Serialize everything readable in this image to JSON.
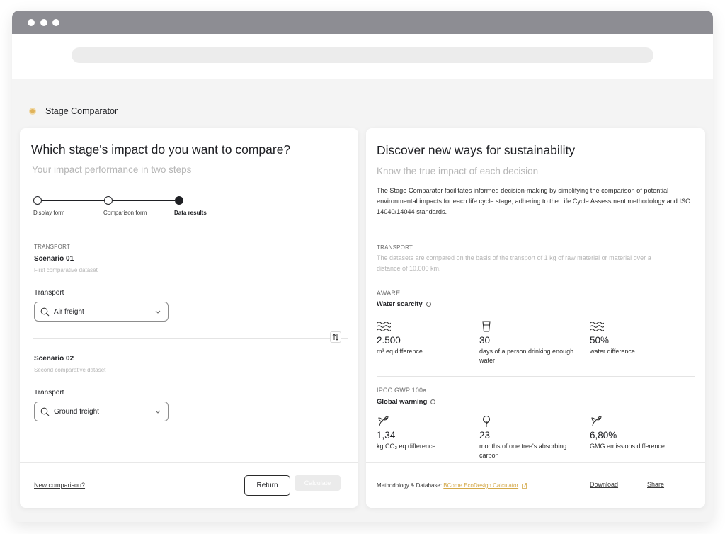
{
  "app": {
    "title": "Stage Comparator"
  },
  "left": {
    "heading": "Which stage's impact do you want to compare?",
    "subheading": "Your impact performance in two steps",
    "steps": [
      {
        "label": "Display form",
        "state": "done"
      },
      {
        "label": "Comparison form",
        "state": "done"
      },
      {
        "label": "Data results",
        "state": "active"
      }
    ],
    "category": "TRANSPORT",
    "scenario1": {
      "title": "Scenario 01",
      "subtitle": "First comparative dataset",
      "field_label": "Transport",
      "value": "Air freight"
    },
    "scenario2": {
      "title": "Scenario 02",
      "subtitle": "Second comparative dataset",
      "field_label": "Transport",
      "value": "Ground freight"
    },
    "footer": {
      "new_comparison": "New comparison?",
      "return_label": "Return",
      "calculate_label": "Calculate"
    }
  },
  "right": {
    "heading": "Discover new ways for sustainability",
    "subheading": "Know the true impact of each decision",
    "description": "The Stage Comparator facilitates informed decision-making by simplifying the comparison of potential environmental impacts for each life cycle stage, adhering to the Life Cycle Assessment methodology and ISO 14040/14044 standards.",
    "category": "TRANSPORT",
    "category_desc": "The datasets are compared on the basis of the transport of 1 kg of raw material or material over a distance of 10.000 km.",
    "aware": {
      "method": "AWARE",
      "title": "Water scarcity",
      "metrics": [
        {
          "icon": "waves-icon",
          "value": "2.500",
          "label": "m³ eq difference"
        },
        {
          "icon": "glass-icon",
          "value": "30",
          "label": "days of a person drinking enough water"
        },
        {
          "icon": "waves-icon",
          "value": "50%",
          "label": "water difference"
        }
      ]
    },
    "ipcc": {
      "method": "IPCC GWP 100a",
      "title": "Global warming",
      "metrics": [
        {
          "icon": "leaf-icon",
          "value": "1,34",
          "label": "kg CO₂ eq difference"
        },
        {
          "icon": "tree-icon",
          "value": "23",
          "label": "months of one tree's absorbing carbon"
        },
        {
          "icon": "leaf-icon",
          "value": "6,80%",
          "label": "GMG emissions difference"
        }
      ]
    },
    "footer": {
      "methodology_prefix": "Methodology & Database:",
      "methodology_link": "BCome EcoDesign Calculator",
      "download": "Download",
      "share": "Share"
    }
  },
  "colors": {
    "accent": "#e0b35a",
    "link": "#d4a94a",
    "text": "#1f2024",
    "muted": "#b6b6b6"
  }
}
